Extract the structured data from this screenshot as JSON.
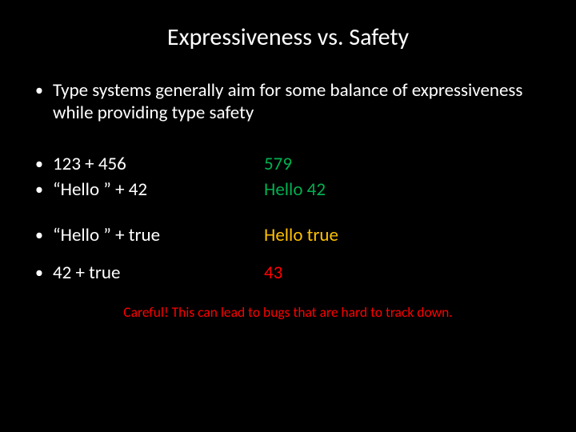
{
  "title": "Expressiveness vs. Safety",
  "intro": "Type systems generally aim for some balance of expressiveness while providing type safety",
  "bullet": "•",
  "rows": [
    {
      "expr": "123 + 456",
      "result": "579",
      "color": "green"
    },
    {
      "expr": "“Hello ” + 42",
      "result": "Hello 42",
      "color": "green"
    },
    {
      "expr": "“Hello ” + true",
      "result": "Hello true",
      "color": "yellow"
    },
    {
      "expr": "42 + true",
      "result": "43",
      "color": "red"
    }
  ],
  "caption": "Careful! This can lead to bugs that are hard to track down."
}
